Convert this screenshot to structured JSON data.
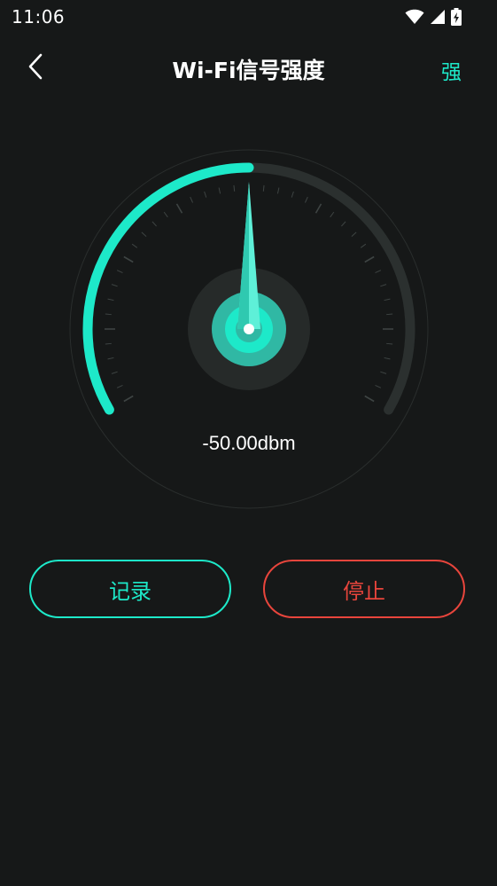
{
  "status_bar": {
    "time": "11:06",
    "icons": [
      "wifi-icon",
      "cellular-signal-icon",
      "battery-charging-icon"
    ]
  },
  "header": {
    "back_icon": "chevron-left-icon",
    "title": "Wi-Fi信号强度",
    "signal_level": "强"
  },
  "gauge": {
    "reading": "-50.00dbm",
    "fill_fraction": 0.5
  },
  "actions": {
    "record_label": "记录",
    "stop_label": "停止"
  },
  "colors": {
    "background": "#161818",
    "accent": "#1de9c9",
    "danger": "#e8453c",
    "track": "#2b302f"
  }
}
